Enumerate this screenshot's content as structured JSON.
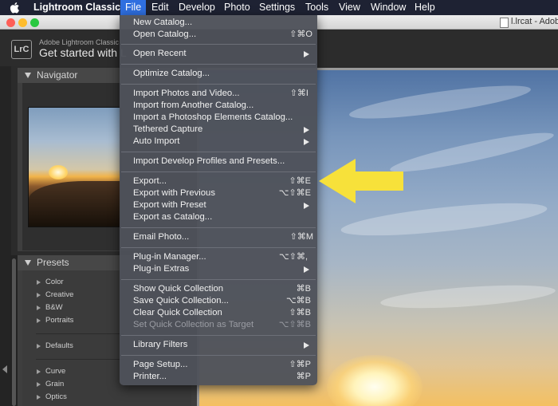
{
  "menubar": {
    "app_name": "Lightroom Classic",
    "menus": [
      "File",
      "Edit",
      "Develop",
      "Photo",
      "Settings",
      "Tools",
      "View",
      "Window",
      "Help"
    ],
    "active_menu": "File"
  },
  "window": {
    "title": "l.lrcat - Adob"
  },
  "header": {
    "logo": "LrC",
    "brand_small": "Adobe Lightroom Classic",
    "brand_big": "Get started with L"
  },
  "left_panel": {
    "navigator_label": "Navigator",
    "presets_label": "Presets",
    "preset_items": [
      "Color",
      "Creative",
      "B&W",
      "Portraits",
      "Defaults",
      "Curve",
      "Grain",
      "Optics"
    ]
  },
  "file_menu": {
    "items": [
      {
        "label": "New Catalog...",
        "shortcut": "",
        "submenu": false,
        "disabled": false
      },
      {
        "label": "Open Catalog...",
        "shortcut": "⇧⌘O",
        "submenu": false,
        "disabled": false
      },
      {
        "label": "Open Recent",
        "shortcut": "",
        "submenu": true,
        "disabled": false
      },
      {
        "label": "Optimize Catalog...",
        "shortcut": "",
        "submenu": false,
        "disabled": false
      },
      {
        "label": "Import Photos and Video...",
        "shortcut": "⇧⌘I",
        "submenu": false,
        "disabled": false
      },
      {
        "label": "Import from Another Catalog...",
        "shortcut": "",
        "submenu": false,
        "disabled": false
      },
      {
        "label": "Import a Photoshop Elements Catalog...",
        "shortcut": "",
        "submenu": false,
        "disabled": false
      },
      {
        "label": "Tethered Capture",
        "shortcut": "",
        "submenu": true,
        "disabled": false
      },
      {
        "label": "Auto Import",
        "shortcut": "",
        "submenu": true,
        "disabled": false
      },
      {
        "label": "Import Develop Profiles and Presets...",
        "shortcut": "",
        "submenu": false,
        "disabled": false
      },
      {
        "label": "Export...",
        "shortcut": "⇧⌘E",
        "submenu": false,
        "disabled": false
      },
      {
        "label": "Export with Previous",
        "shortcut": "⌥⇧⌘E",
        "submenu": false,
        "disabled": false
      },
      {
        "label": "Export with Preset",
        "shortcut": "",
        "submenu": true,
        "disabled": false
      },
      {
        "label": "Export as Catalog...",
        "shortcut": "",
        "submenu": false,
        "disabled": false
      },
      {
        "label": "Email Photo...",
        "shortcut": "⇧⌘M",
        "submenu": false,
        "disabled": false
      },
      {
        "label": "Plug-in Manager...",
        "shortcut": "⌥⇧⌘,",
        "submenu": false,
        "disabled": false
      },
      {
        "label": "Plug-in Extras",
        "shortcut": "",
        "submenu": true,
        "disabled": false
      },
      {
        "label": "Show Quick Collection",
        "shortcut": "⌘B",
        "submenu": false,
        "disabled": false
      },
      {
        "label": "Save Quick Collection...",
        "shortcut": "⌥⌘B",
        "submenu": false,
        "disabled": false
      },
      {
        "label": "Clear Quick Collection",
        "shortcut": "⇧⌘B",
        "submenu": false,
        "disabled": false
      },
      {
        "label": "Set Quick Collection as Target",
        "shortcut": "⌥⇧⌘B",
        "submenu": false,
        "disabled": true
      },
      {
        "label": "Library Filters",
        "shortcut": "",
        "submenu": true,
        "disabled": false
      },
      {
        "label": "Page Setup...",
        "shortcut": "⇧⌘P",
        "submenu": false,
        "disabled": false
      },
      {
        "label": "Printer...",
        "shortcut": "⌘P",
        "submenu": false,
        "disabled": false
      }
    ]
  },
  "colors": {
    "menubar_bg": "#1e2233",
    "menu_highlight": "#2f6fe0",
    "dropdown_bg": "#4e515a",
    "callout_arrow": "#f7e13a",
    "traffic_close": "#fe5f57",
    "traffic_minimize": "#febc2e",
    "traffic_zoom": "#28c840"
  }
}
